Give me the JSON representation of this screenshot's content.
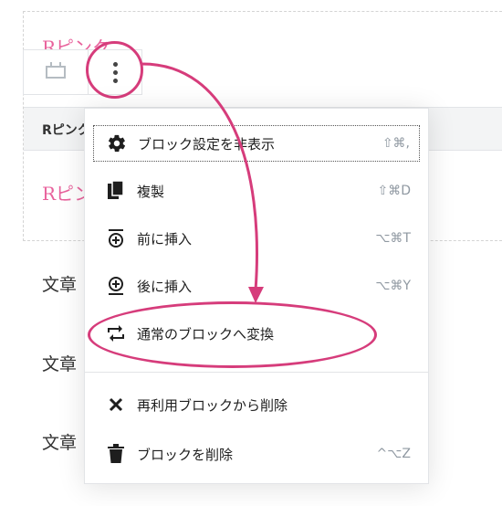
{
  "editor": {
    "heading_top": "Rピンク",
    "heading_bottom": "Rピンク",
    "reusable_bar_label": "Rピンク",
    "paragraphs": [
      "文章",
      "文章",
      "文章"
    ]
  },
  "toolbar": {
    "reusable_icon": "reusable-block-icon",
    "more_icon": "more-vertical-icon"
  },
  "menu": {
    "items": [
      {
        "icon": "gear-icon",
        "label": "ブロック設定を非表示",
        "shortcut": "⇧⌘,"
      },
      {
        "icon": "copy-icon",
        "label": "複製",
        "shortcut": "⇧⌘D"
      },
      {
        "icon": "insert-before-icon",
        "label": "前に挿入",
        "shortcut": "⌥⌘T"
      },
      {
        "icon": "insert-after-icon",
        "label": "後に挿入",
        "shortcut": "⌥⌘Y"
      },
      {
        "icon": "convert-icon",
        "label": "通常のブロックへ変換",
        "shortcut": ""
      },
      {
        "icon": "close-icon",
        "label": "再利用ブロックから削除",
        "shortcut": ""
      },
      {
        "icon": "trash-icon",
        "label": "ブロックを削除",
        "shortcut": "^⌥Z"
      }
    ]
  },
  "annotation": {
    "color": "#d63c7b"
  },
  "colors": {
    "accent_pink": "#e8629c"
  }
}
